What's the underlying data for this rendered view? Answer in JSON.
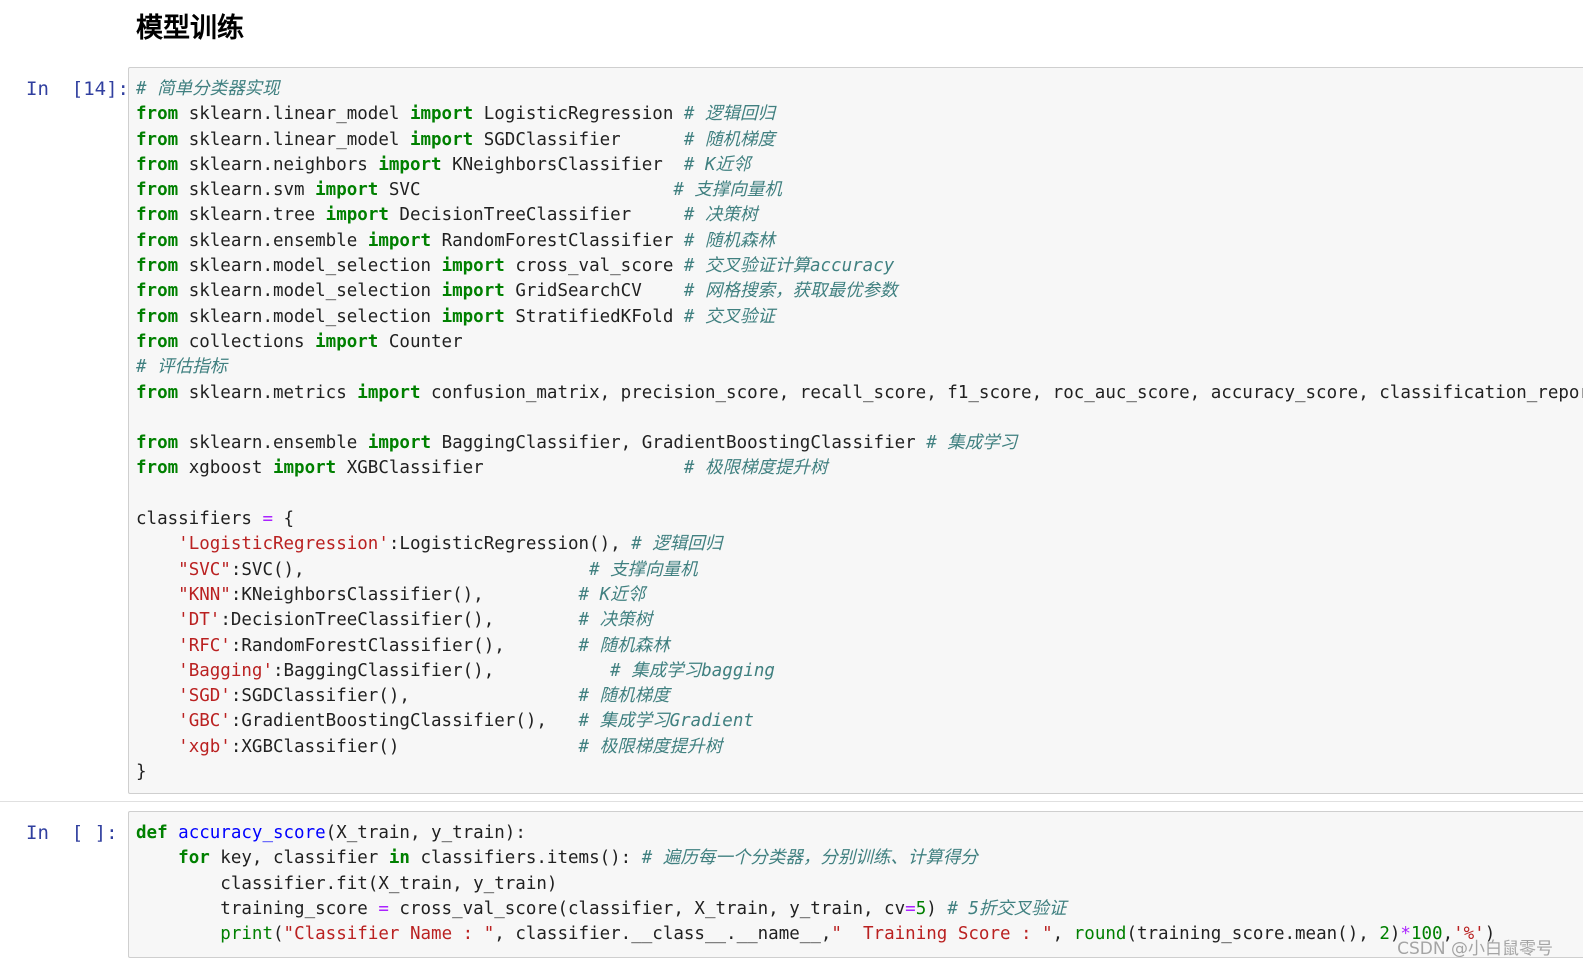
{
  "notebook": {
    "heading": "模型训练",
    "watermark": "CSDN @小白鼠零号",
    "cells": [
      {
        "prompt": "In  [14]:",
        "lines": [
          [
            [
              "c",
              "# 简单分类器实现"
            ]
          ],
          [
            [
              "k",
              "from"
            ],
            [
              "p",
              " sklearn.linear_model "
            ],
            [
              "k",
              "import"
            ],
            [
              "p",
              " LogisticRegression "
            ],
            [
              "c",
              "# 逻辑回归"
            ]
          ],
          [
            [
              "k",
              "from"
            ],
            [
              "p",
              " sklearn.linear_model "
            ],
            [
              "k",
              "import"
            ],
            [
              "p",
              " SGDClassifier      "
            ],
            [
              "c",
              "# 随机梯度"
            ]
          ],
          [
            [
              "k",
              "from"
            ],
            [
              "p",
              " sklearn.neighbors "
            ],
            [
              "k",
              "import"
            ],
            [
              "p",
              " KNeighborsClassifier  "
            ],
            [
              "c",
              "# K近邻"
            ]
          ],
          [
            [
              "k",
              "from"
            ],
            [
              "p",
              " sklearn.svm "
            ],
            [
              "k",
              "import"
            ],
            [
              "p",
              " SVC                        "
            ],
            [
              "c",
              "# 支撑向量机"
            ]
          ],
          [
            [
              "k",
              "from"
            ],
            [
              "p",
              " sklearn.tree "
            ],
            [
              "k",
              "import"
            ],
            [
              "p",
              " DecisionTreeClassifier     "
            ],
            [
              "c",
              "# 决策树"
            ]
          ],
          [
            [
              "k",
              "from"
            ],
            [
              "p",
              " sklearn.ensemble "
            ],
            [
              "k",
              "import"
            ],
            [
              "p",
              " RandomForestClassifier "
            ],
            [
              "c",
              "# 随机森林"
            ]
          ],
          [
            [
              "k",
              "from"
            ],
            [
              "p",
              " sklearn.model_selection "
            ],
            [
              "k",
              "import"
            ],
            [
              "p",
              " cross_val_score "
            ],
            [
              "c",
              "# 交叉验证计算accuracy"
            ]
          ],
          [
            [
              "k",
              "from"
            ],
            [
              "p",
              " sklearn.model_selection "
            ],
            [
              "k",
              "import"
            ],
            [
              "p",
              " GridSearchCV    "
            ],
            [
              "c",
              "# 网格搜索，获取最优参数"
            ]
          ],
          [
            [
              "k",
              "from"
            ],
            [
              "p",
              " sklearn.model_selection "
            ],
            [
              "k",
              "import"
            ],
            [
              "p",
              " StratifiedKFold "
            ],
            [
              "c",
              "# 交叉验证"
            ]
          ],
          [
            [
              "k",
              "from"
            ],
            [
              "p",
              " collections "
            ],
            [
              "k",
              "import"
            ],
            [
              "p",
              " Counter"
            ]
          ],
          [
            [
              "c",
              "# 评估指标"
            ]
          ],
          [
            [
              "k",
              "from"
            ],
            [
              "p",
              " sklearn.metrics "
            ],
            [
              "k",
              "import"
            ],
            [
              "p",
              " confusion_matrix, precision_score, recall_score, f1_score, roc_auc_score, accuracy_score, classification_report"
            ]
          ],
          [],
          [
            [
              "k",
              "from"
            ],
            [
              "p",
              " sklearn.ensemble "
            ],
            [
              "k",
              "import"
            ],
            [
              "p",
              " BaggingClassifier, GradientBoostingClassifier "
            ],
            [
              "c",
              "# 集成学习"
            ]
          ],
          [
            [
              "k",
              "from"
            ],
            [
              "p",
              " xgboost "
            ],
            [
              "k",
              "import"
            ],
            [
              "p",
              " XGBClassifier                   "
            ],
            [
              "c",
              "# 极限梯度提升树"
            ]
          ],
          [],
          [
            [
              "p",
              "classifiers "
            ],
            [
              "o",
              "="
            ],
            [
              "p",
              " {"
            ]
          ],
          [
            [
              "p",
              "    "
            ],
            [
              "s",
              "'LogisticRegression'"
            ],
            [
              "p",
              ":LogisticRegression(), "
            ],
            [
              "c",
              "# 逻辑回归"
            ]
          ],
          [
            [
              "p",
              "    "
            ],
            [
              "s",
              "\"SVC\""
            ],
            [
              "p",
              ":SVC(),                           "
            ],
            [
              "c",
              "# 支撑向量机"
            ]
          ],
          [
            [
              "p",
              "    "
            ],
            [
              "s",
              "\"KNN\""
            ],
            [
              "p",
              ":KNeighborsClassifier(),         "
            ],
            [
              "c",
              "# K近邻"
            ]
          ],
          [
            [
              "p",
              "    "
            ],
            [
              "s",
              "'DT'"
            ],
            [
              "p",
              ":DecisionTreeClassifier(),        "
            ],
            [
              "c",
              "# 决策树"
            ]
          ],
          [
            [
              "p",
              "    "
            ],
            [
              "s",
              "'RFC'"
            ],
            [
              "p",
              ":RandomForestClassifier(),       "
            ],
            [
              "c",
              "# 随机森林"
            ]
          ],
          [
            [
              "p",
              "    "
            ],
            [
              "s",
              "'Bagging'"
            ],
            [
              "p",
              ":BaggingClassifier(),           "
            ],
            [
              "c",
              "# 集成学习bagging"
            ]
          ],
          [
            [
              "p",
              "    "
            ],
            [
              "s",
              "'SGD'"
            ],
            [
              "p",
              ":SGDClassifier(),                "
            ],
            [
              "c",
              "# 随机梯度"
            ]
          ],
          [
            [
              "p",
              "    "
            ],
            [
              "s",
              "'GBC'"
            ],
            [
              "p",
              ":GradientBoostingClassifier(),   "
            ],
            [
              "c",
              "# 集成学习Gradient"
            ]
          ],
          [
            [
              "p",
              "    "
            ],
            [
              "s",
              "'xgb'"
            ],
            [
              "p",
              ":XGBClassifier()                 "
            ],
            [
              "c",
              "# 极限梯度提升树"
            ]
          ],
          [
            [
              "p",
              "}"
            ]
          ]
        ]
      },
      {
        "prompt": "In  [ ]:",
        "lines": [
          [
            [
              "k",
              "def"
            ],
            [
              "p",
              " "
            ],
            [
              "d",
              "accuracy_score"
            ],
            [
              "p",
              "(X_train, y_train):"
            ]
          ],
          [
            [
              "p",
              "    "
            ],
            [
              "k",
              "for"
            ],
            [
              "p",
              " key, classifier "
            ],
            [
              "k",
              "in"
            ],
            [
              "p",
              " classifiers.items(): "
            ],
            [
              "c",
              "# 遍历每一个分类器，分别训练、计算得分"
            ]
          ],
          [
            [
              "p",
              "        classifier.fit(X_train, y_train)"
            ]
          ],
          [
            [
              "p",
              "        training_score "
            ],
            [
              "o",
              "="
            ],
            [
              "p",
              " cross_val_score(classifier, X_train, y_train, cv"
            ],
            [
              "o",
              "="
            ],
            [
              "n",
              "5"
            ],
            [
              "p",
              ") "
            ],
            [
              "c",
              "# 5折交叉验证"
            ]
          ],
          [
            [
              "p",
              "        "
            ],
            [
              "b",
              "print"
            ],
            [
              "p",
              "("
            ],
            [
              "s",
              "\"Classifier Name : \""
            ],
            [
              "p",
              ", classifier.__class__.__name__,"
            ],
            [
              "s",
              "\"  Training Score : \""
            ],
            [
              "p",
              ", "
            ],
            [
              "b",
              "round"
            ],
            [
              "p",
              "(training_score.mean(), "
            ],
            [
              "n",
              "2"
            ],
            [
              "p",
              ")"
            ],
            [
              "o",
              "*"
            ],
            [
              "n",
              "100"
            ],
            [
              "p",
              ","
            ],
            [
              "s",
              "'%'"
            ],
            [
              "p",
              ")"
            ]
          ]
        ]
      }
    ]
  }
}
